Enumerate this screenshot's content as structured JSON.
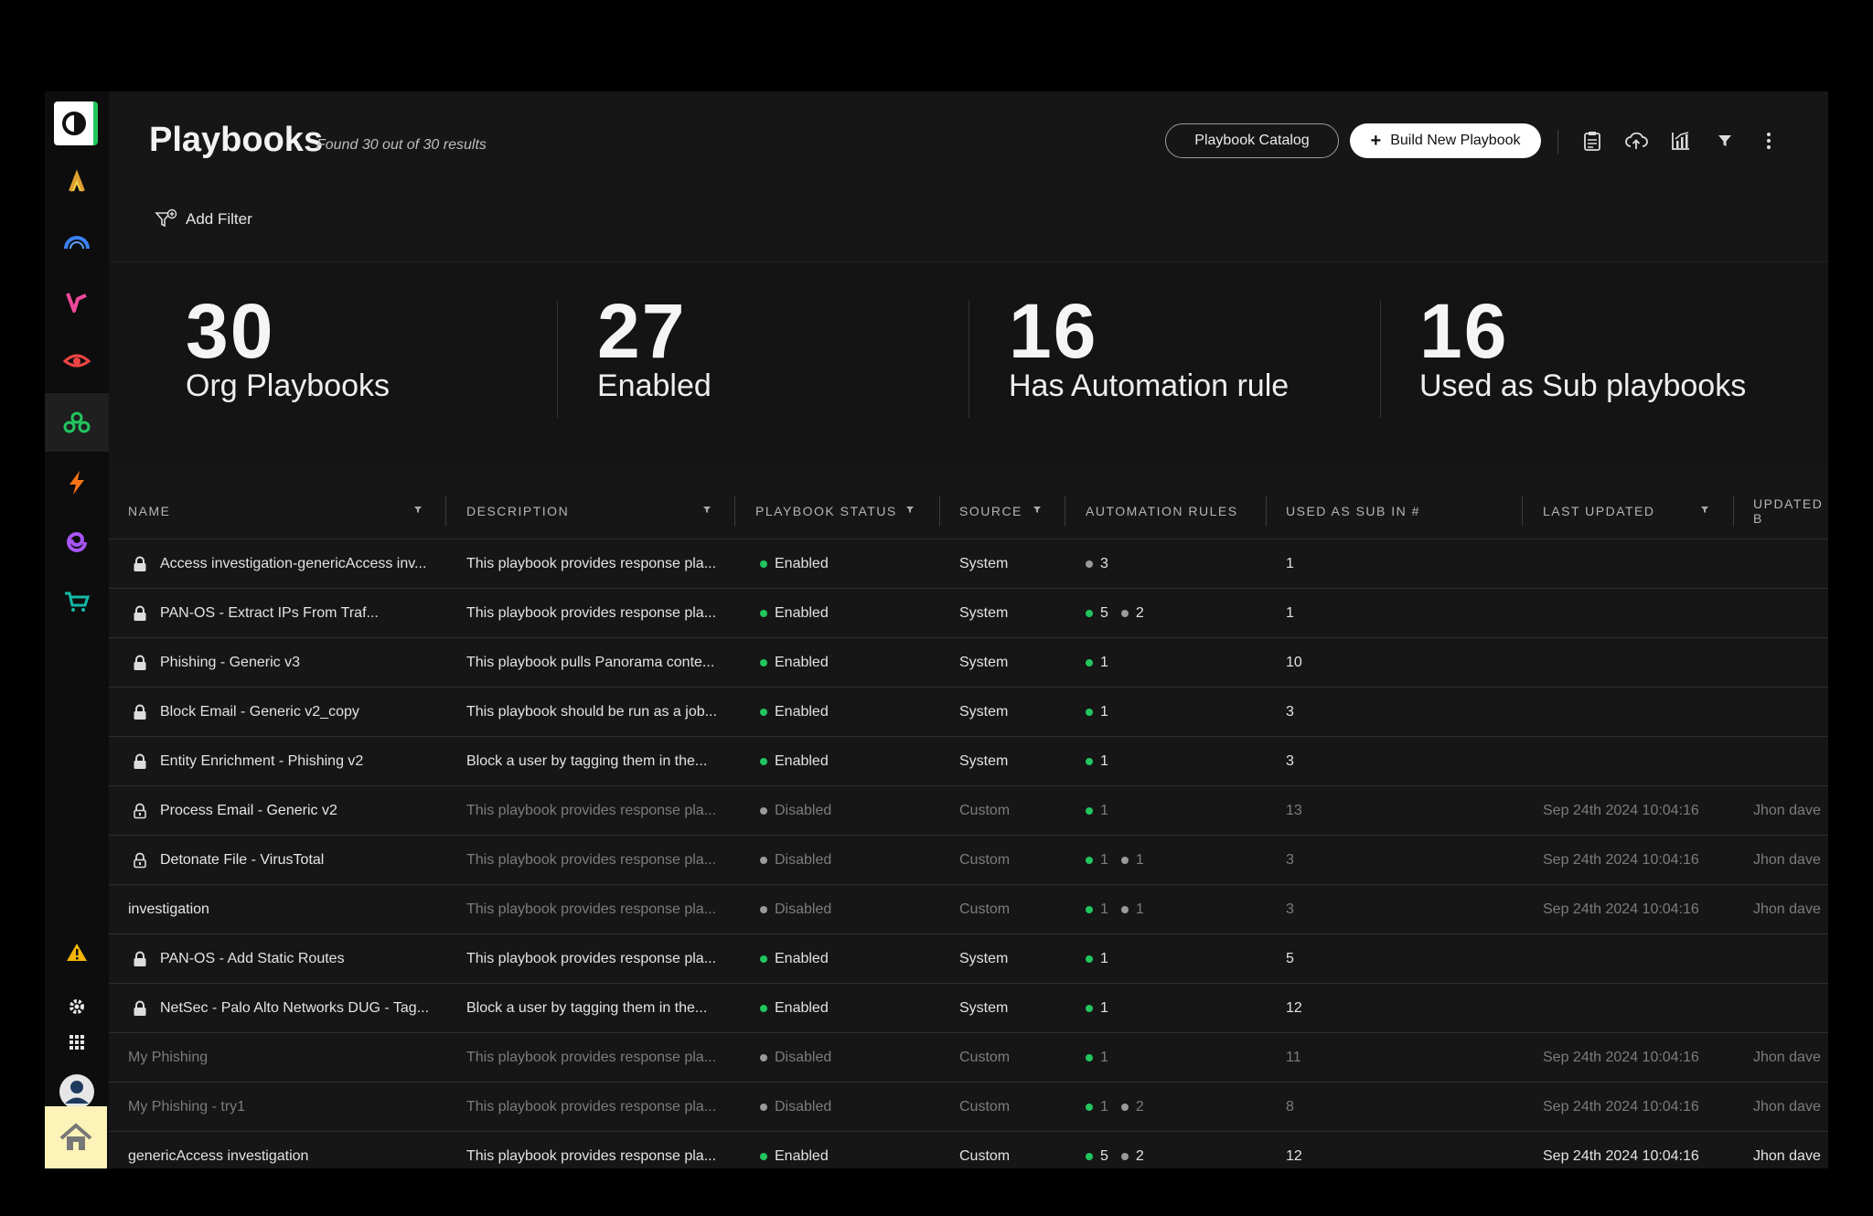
{
  "page": {
    "title": "Playbooks",
    "results_note": "Found 30 out of 30 results",
    "catalog_button": "Playbook Catalog",
    "build_button": "Build New Playbook",
    "add_filter": "Add Filter"
  },
  "stats": [
    {
      "value": "30",
      "label": "Org Playbooks"
    },
    {
      "value": "27",
      "label": "Enabled"
    },
    {
      "value": "16",
      "label": "Has Automation rule"
    },
    {
      "value": "16",
      "label": "Used as Sub playbooks"
    }
  ],
  "columns": {
    "name": "NAME",
    "description": "DESCRIPTION",
    "status": "PLAYBOOK STATUS",
    "source": "SOURCE",
    "automation": "AUTOMATION RULES",
    "used_sub": "USED AS SUB IN #",
    "last_updated": "LAST UPDATED",
    "updated_by": "UPDATED B"
  },
  "rows": [
    {
      "name": "Access investigation-genericAccess inv...",
      "lock": "locked",
      "description": "This playbook provides response pla...",
      "status": "Enabled",
      "source": "System",
      "rules": [
        {
          "color": "grey",
          "count": "3"
        }
      ],
      "used_sub": "1",
      "last_updated": "",
      "updated_by": "",
      "style": "normal"
    },
    {
      "name": "PAN-OS - Extract IPs From Traf...",
      "lock": "locked",
      "description": "This playbook provides response pla...",
      "status": "Enabled",
      "source": "System",
      "rules": [
        {
          "color": "green",
          "count": "5"
        },
        {
          "color": "grey",
          "count": "2"
        }
      ],
      "used_sub": "1",
      "last_updated": "",
      "updated_by": "",
      "style": "normal"
    },
    {
      "name": "Phishing - Generic v3",
      "lock": "locked",
      "description": "This playbook pulls Panorama conte...",
      "status": "Enabled",
      "source": "System",
      "rules": [
        {
          "color": "green",
          "count": "1"
        }
      ],
      "used_sub": "10",
      "last_updated": "",
      "updated_by": "",
      "style": "normal"
    },
    {
      "name": "Block Email - Generic v2_copy",
      "lock": "locked",
      "description": "This playbook should be run as a job...",
      "status": "Enabled",
      "source": "System",
      "rules": [
        {
          "color": "green",
          "count": "1"
        }
      ],
      "used_sub": "3",
      "last_updated": "",
      "updated_by": "",
      "style": "normal"
    },
    {
      "name": "Entity Enrichment - Phishing v2",
      "lock": "locked",
      "description": "Block a user by tagging them in the...",
      "status": "Enabled",
      "source": "System",
      "rules": [
        {
          "color": "green",
          "count": "1"
        }
      ],
      "used_sub": "3",
      "last_updated": "",
      "updated_by": "",
      "style": "normal"
    },
    {
      "name": "Process Email - Generic v2",
      "lock": "unlocked",
      "description": "This playbook provides response pla...",
      "status": "Disabled",
      "source": "Custom",
      "rules": [
        {
          "color": "green",
          "count": "1"
        }
      ],
      "used_sub": "13",
      "last_updated": "Sep 24th 2024 10:04:16",
      "updated_by": "Jhon dave",
      "style": "dim"
    },
    {
      "name": "Detonate File - VirusTotal",
      "lock": "unlocked",
      "description": "This playbook provides response pla...",
      "status": "Disabled",
      "source": "Custom",
      "rules": [
        {
          "color": "green",
          "count": "1"
        },
        {
          "color": "grey",
          "count": "1"
        }
      ],
      "used_sub": "3",
      "last_updated": "Sep 24th 2024 10:04:16",
      "updated_by": "Jhon dave",
      "style": "dim"
    },
    {
      "name": "investigation",
      "lock": "none",
      "description": "This playbook provides response pla...",
      "status": "Disabled",
      "source": "Custom",
      "rules": [
        {
          "color": "green",
          "count": "1"
        },
        {
          "color": "grey",
          "count": "1"
        }
      ],
      "used_sub": "3",
      "last_updated": "Sep 24th 2024 10:04:16",
      "updated_by": "Jhon dave",
      "style": "dim"
    },
    {
      "name": "PAN-OS - Add Static Routes",
      "lock": "locked",
      "description": "This playbook provides response pla...",
      "status": "Enabled",
      "source": "System",
      "rules": [
        {
          "color": "green",
          "count": "1"
        }
      ],
      "used_sub": "5",
      "last_updated": "",
      "updated_by": "",
      "style": "normal"
    },
    {
      "name": "NetSec - Palo Alto Networks DUG - Tag...",
      "lock": "locked",
      "description": "Block a user by tagging them in the...",
      "status": "Enabled",
      "source": "System",
      "rules": [
        {
          "color": "green",
          "count": "1"
        }
      ],
      "used_sub": "12",
      "last_updated": "",
      "updated_by": "",
      "style": "normal"
    },
    {
      "name": "My Phishing",
      "lock": "none",
      "description": "This playbook provides response pla...",
      "status": "Disabled",
      "source": "Custom",
      "rules": [
        {
          "color": "green",
          "count": "1"
        }
      ],
      "used_sub": "11",
      "last_updated": "Sep 24th 2024 10:04:16",
      "updated_by": "Jhon dave",
      "style": "dimall"
    },
    {
      "name": "My Phishing - try1",
      "lock": "none",
      "description": "This playbook provides response pla...",
      "status": "Disabled",
      "source": "Custom",
      "rules": [
        {
          "color": "green",
          "count": "1"
        },
        {
          "color": "grey",
          "count": "2"
        }
      ],
      "used_sub": "8",
      "last_updated": "Sep 24th 2024 10:04:16",
      "updated_by": "Jhon dave",
      "style": "dimall"
    },
    {
      "name": "genericAccess investigation",
      "lock": "none",
      "description": "This playbook provides response pla...",
      "status": "Enabled",
      "source": "Custom",
      "rules": [
        {
          "color": "green",
          "count": "5"
        },
        {
          "color": "grey",
          "count": "2"
        }
      ],
      "used_sub": "12",
      "last_updated": "Sep 24th 2024 10:04:16",
      "updated_by": "Jhon dave",
      "style": "normal"
    }
  ],
  "colors": {
    "enabled": "#22c55e",
    "disabled": "#9a9a9a",
    "accent": "#22c55e"
  },
  "icons": {
    "sidebar": [
      "cortex-logo-icon",
      "caret-logo-icon",
      "gauge-icon",
      "pulse-v-icon",
      "eye-icon",
      "playbooks-icon",
      "lightning-icon",
      "swirl-icon",
      "cart-icon",
      "warning-icon",
      "gear-icon",
      "grid-icon",
      "user-avatar-icon",
      "home-icon"
    ],
    "toolbar": [
      "clipboard-icon",
      "cloud-upload-icon",
      "chart-icon",
      "filter-icon",
      "more-vertical-icon"
    ]
  }
}
